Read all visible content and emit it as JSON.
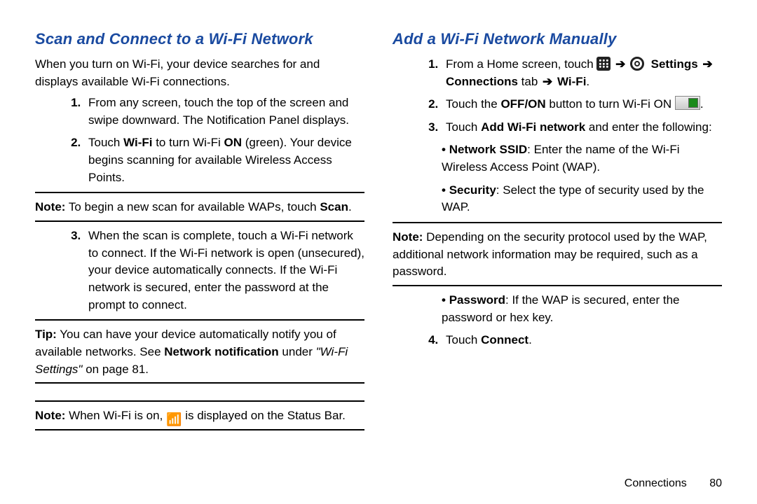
{
  "left": {
    "heading": "Scan and Connect to a Wi-Fi Network",
    "intro": "When you turn on Wi-Fi, your device searches for and displays available Wi-Fi connections.",
    "step1": "From any screen, touch the top of the screen and swipe downward. The Notification Panel displays.",
    "step2_a": "Touch ",
    "step2_b": "Wi-Fi",
    "step2_c": " to turn Wi-Fi ",
    "step2_d": "ON",
    "step2_e": " (green). Your device begins scanning for available Wireless Access Points.",
    "note1_label": "Note:",
    "note1_a": " To begin a new scan for available WAPs, touch ",
    "note1_b": "Scan",
    "note1_c": ".",
    "step3": "When the scan is complete, touch a Wi-Fi network to connect. If the Wi-Fi network is open (unsecured), your device automatically connects. If the Wi-Fi network is secured, enter the password at the prompt to connect.",
    "tip_label": "Tip:",
    "tip_a": " You can have your device automatically notify you of available networks. See ",
    "tip_b": "Network notification",
    "tip_c": " under ",
    "tip_link": "\"Wi-Fi Settings\"",
    "tip_d": " on page 81.",
    "note2_label": "Note:",
    "note2_a": " When Wi-Fi is on, ",
    "note2_b": " is displayed on the Status Bar."
  },
  "right": {
    "heading": "Add a Wi-Fi Network Manually",
    "s1_a": "From a Home screen, touch ",
    "s1_arrow": "➔",
    "s1_settings": "Settings",
    "s1_b": "Connections",
    "s1_tab": " tab ",
    "s1_wifi": "Wi-Fi",
    "s1_dot": ".",
    "s2_a": "Touch the ",
    "s2_b": "OFF/ON",
    "s2_c": " button to turn Wi-Fi ON ",
    "s2_d": ".",
    "s3_a": "Touch ",
    "s3_b": "Add Wi-Fi network",
    "s3_c": " and enter the following:",
    "bul1_a": "Network SSID",
    "bul1_b": ": Enter the name of the Wi-Fi Wireless Access Point (WAP).",
    "bul2_a": "Security",
    "bul2_b": ": Select the type of security used by the WAP.",
    "note_label": "Note:",
    "note_text": " Depending on the security protocol used by the WAP, additional network information may be required, such as a password.",
    "bul3_a": "Password",
    "bul3_b": ": If the WAP is secured, enter the password or hex key.",
    "s4_a": "Touch ",
    "s4_b": "Connect",
    "s4_c": "."
  },
  "footer": {
    "section": "Connections",
    "page": "80"
  }
}
